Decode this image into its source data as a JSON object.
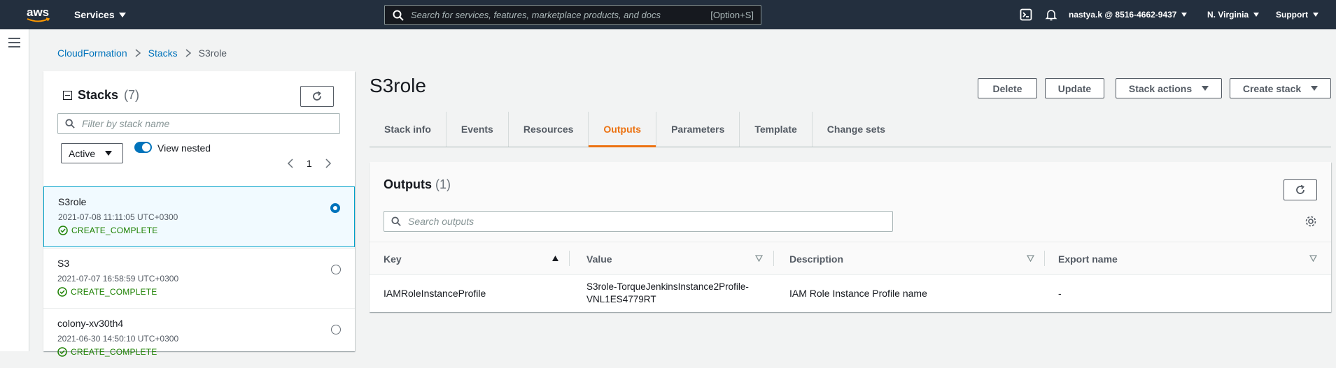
{
  "topbar": {
    "logo": "aws",
    "services": "Services",
    "search_placeholder": "Search for services, features, marketplace products, and docs",
    "search_shortcut": "[Option+S]",
    "account": "nastya.k @ 8516-4662-9437",
    "region": "N. Virginia",
    "support": "Support"
  },
  "breadcrumb": {
    "items": [
      "CloudFormation",
      "Stacks"
    ],
    "current": "S3role"
  },
  "stacks_panel": {
    "title": "Stacks",
    "count": "(7)",
    "filter_placeholder": "Filter by stack name",
    "status_filter": "Active",
    "view_nested": "View nested",
    "page": "1",
    "items": [
      {
        "name": "S3role",
        "date": "2021-07-08 11:11:05 UTC+0300",
        "status": "CREATE_COMPLETE"
      },
      {
        "name": "S3",
        "date": "2021-07-07 16:58:59 UTC+0300",
        "status": "CREATE_COMPLETE"
      },
      {
        "name": "colony-xv30th4",
        "date": "2021-06-30 14:50:10 UTC+0300",
        "status": "CREATE_COMPLETE"
      }
    ]
  },
  "detail": {
    "title": "S3role",
    "buttons": {
      "delete": "Delete",
      "update": "Update",
      "stack_actions": "Stack actions",
      "create_stack": "Create stack"
    },
    "tabs": [
      "Stack info",
      "Events",
      "Resources",
      "Outputs",
      "Parameters",
      "Template",
      "Change sets"
    ],
    "active_tab": "Outputs"
  },
  "outputs": {
    "title": "Outputs",
    "count": "(1)",
    "search_placeholder": "Search outputs",
    "columns": [
      "Key",
      "Value",
      "Description",
      "Export name"
    ],
    "rows": [
      {
        "key": "IAMRoleInstanceProfile",
        "value_line1": "S3role-TorqueJenkinsInstance2Profile-",
        "value_line2": "VNL1ES4779RT",
        "description": "IAM Role Instance Profile name",
        "export": "-"
      }
    ]
  },
  "colors": {
    "topbar": "#232f3e",
    "link": "#0073bb",
    "accent": "#ec7211",
    "success": "#1d8102"
  }
}
